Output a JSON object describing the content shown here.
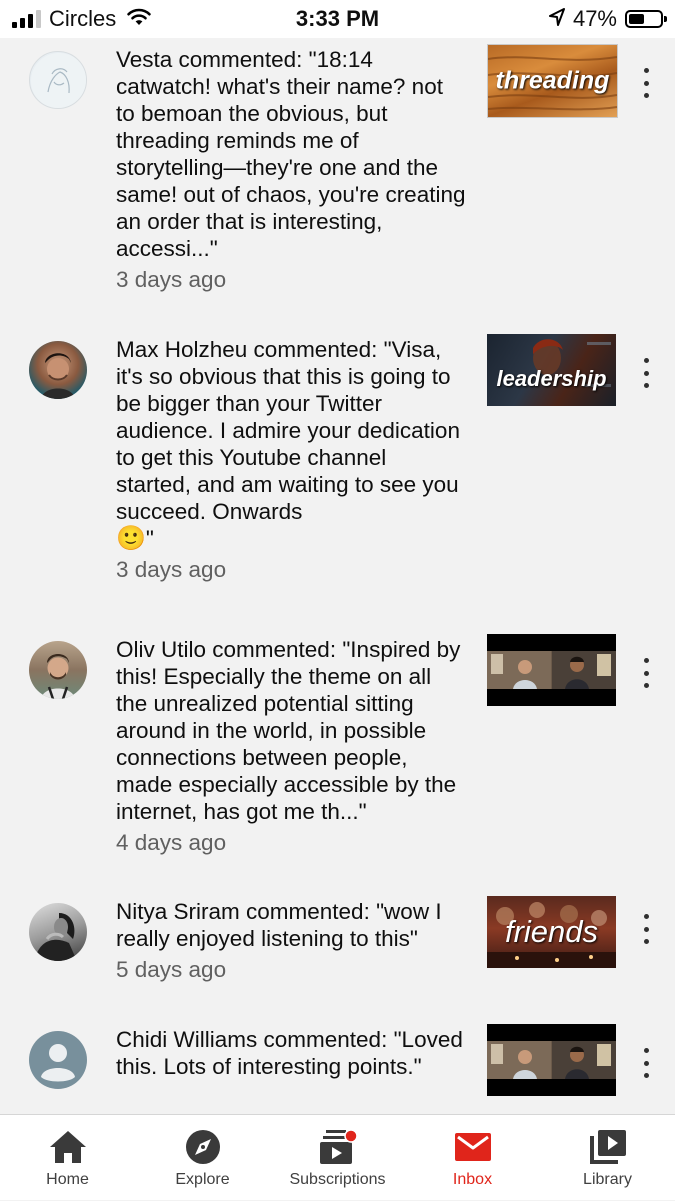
{
  "status_bar": {
    "carrier": "Circles",
    "time": "3:33 PM",
    "battery": "47%",
    "icons": [
      "signal-icon",
      "wifi-icon",
      "location-arrow-icon",
      "battery-icon"
    ]
  },
  "notifications": [
    {
      "text": "Vesta commented: \"18:14 catwatch! what's their name? not to bemoan the obvious, but threading reminds me of storytelling—they're one and the same! out of chaos, you're creating an order that is interesting, accessi...\"",
      "time": "3 days ago",
      "thumbnail_title": "threading"
    },
    {
      "text": "Max Holzheu commented: \"Visa, it's so obvious that this is going to be bigger than your Twitter audience. I admire your dedication to get this Youtube channel started, and am waiting to see you succeed. Onwards",
      "emoji": "🙂",
      "text_end": "\"",
      "time": "3 days ago",
      "thumbnail_title": "leadership"
    },
    {
      "text": "Oliv Utilo commented: \"Inspired by this! Especially the theme on all the unrealized potential sitting around in the world, in possible connections between people, made especially accessible by the internet, has got me th...\"",
      "time": "4 days ago",
      "thumbnail_title": ""
    },
    {
      "text": "Nitya Sriram commented: \"wow I really enjoyed listening to this\"",
      "time": "5 days ago",
      "thumbnail_title": "friends"
    },
    {
      "text": "Chidi Williams commented: \"Loved this. Lots of interesting points.\"",
      "time": "",
      "thumbnail_title": ""
    }
  ],
  "bottom_nav": {
    "items": [
      {
        "label": "Home",
        "icon": "home-icon"
      },
      {
        "label": "Explore",
        "icon": "compass-icon"
      },
      {
        "label": "Subscriptions",
        "icon": "subscriptions-icon"
      },
      {
        "label": "Inbox",
        "icon": "inbox-icon",
        "active": true
      },
      {
        "label": "Library",
        "icon": "library-icon"
      }
    ]
  },
  "colors": {
    "accent": "#e0251b",
    "background": "#f2f2f2",
    "secondary_text": "#606060"
  }
}
